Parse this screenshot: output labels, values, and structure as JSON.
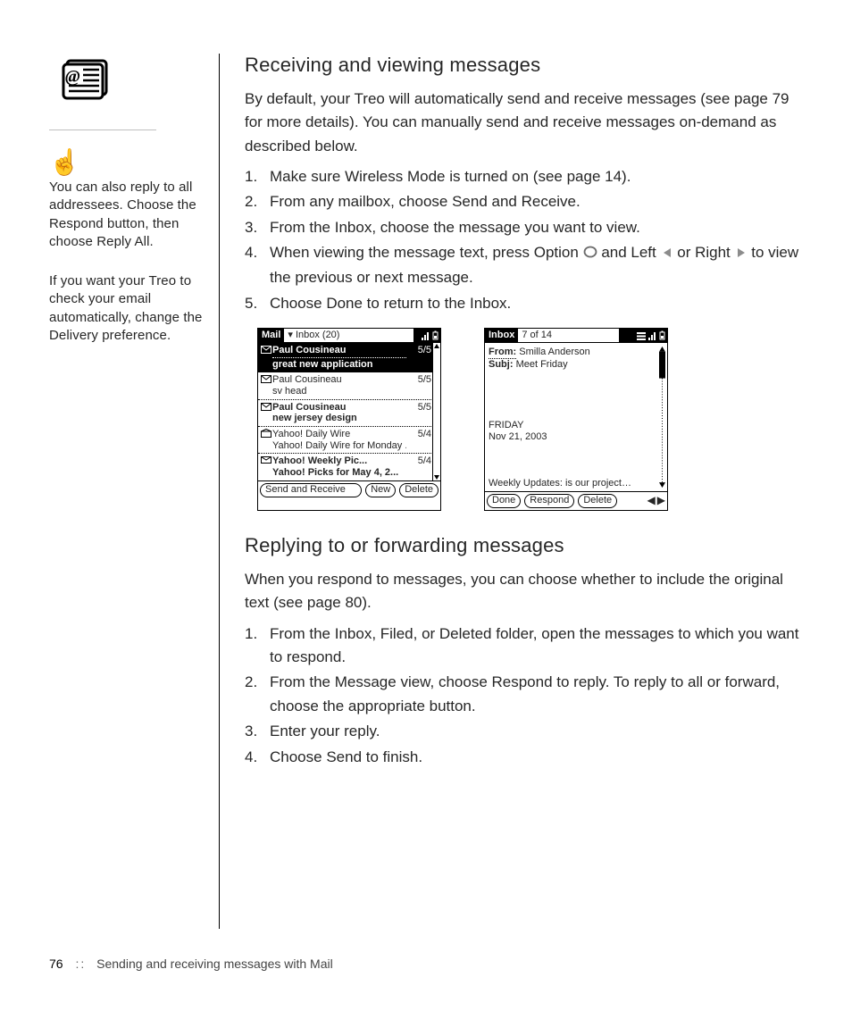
{
  "sidebar": {
    "tip1": "You can also reply to all addressees. Choose the Respond button, then choose Reply All.",
    "tip2": "If you want your Treo to check your email automatically, change the Delivery preference."
  },
  "section1": {
    "heading": "Receiving and viewing messages",
    "intro": "By default, your Treo will automatically send and receive messages (see page 79 for more details). You can manually send and receive messages on-demand as described below.",
    "steps": [
      "Make sure Wireless Mode is turned on (see page 14).",
      "From any mailbox, choose Send and Receive.",
      "From the Inbox, choose the message you want to view.",
      "When viewing the message text, press Option",
      "and Left",
      "or Right",
      "to view the previous or next message.",
      "Choose Done to return to the Inbox."
    ]
  },
  "screen1": {
    "title": "Mail",
    "folder": "Inbox (20)",
    "rows": [
      {
        "sender": "Paul Cousineau",
        "subject": "great new application",
        "date": "5/5",
        "bold": true,
        "selected": true
      },
      {
        "sender": "Paul Cousineau",
        "subject": "sv head",
        "date": "5/5",
        "bold": false,
        "selected": false
      },
      {
        "sender": "Paul Cousineau",
        "subject": "new jersey design",
        "date": "5/5",
        "bold": true,
        "selected": false
      },
      {
        "sender": "Yahoo! Daily Wire",
        "subject": "Yahoo! Daily Wire for Monday ...",
        "date": "5/4",
        "bold": false,
        "selected": false
      },
      {
        "sender": "Yahoo! Weekly Pic...",
        "subject": "Yahoo! Picks for May 4, 2...",
        "date": "5/4",
        "bold": true,
        "selected": false
      }
    ],
    "buttons": {
      "sendrecv": "Send and Receive",
      "new": "New",
      "delete": "Delete"
    }
  },
  "screen2": {
    "title": "Inbox",
    "counter": "7 of 14",
    "from_label": "From:",
    "from_value": "Smilla Anderson",
    "subj_label": "Subj:",
    "subj_value": "Meet Friday",
    "body_l1": "FRIDAY",
    "body_l2": "Nov 21, 2003",
    "body_l3": "Weekly Updates: is our project…",
    "buttons": {
      "done": "Done",
      "respond": "Respond",
      "delete": "Delete"
    }
  },
  "section2": {
    "heading": "Replying to or forwarding messages",
    "intro": "When you respond to messages, you can choose whether to include the original text (see page 80).",
    "steps": [
      "From the Inbox, Filed, or Deleted folder, open the messages to which you want to respond.",
      "From the Message view, choose Respond to reply. To reply to all or forward, choose the appropriate button.",
      "Enter your reply.",
      "Choose Send to finish."
    ]
  },
  "footer": {
    "page": "76",
    "sep": "::",
    "chapter": "Sending and receiving messages with Mail"
  }
}
